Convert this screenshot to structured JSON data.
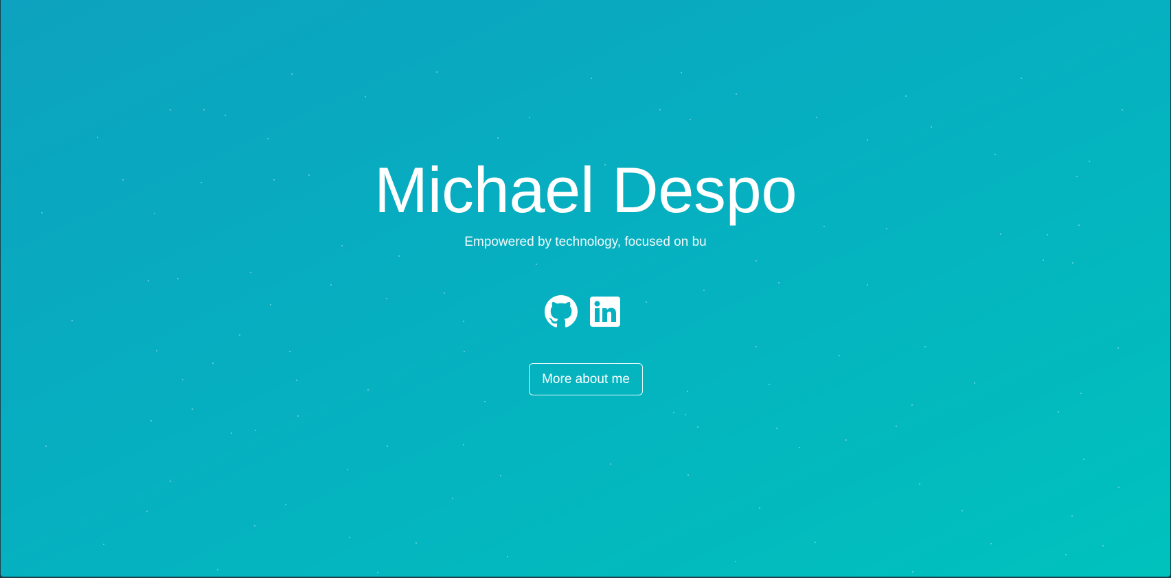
{
  "hero": {
    "title": "Michael Despo",
    "subtitle": "Empowered by technology, focused on bu",
    "accent_gradient": [
      "#0da2bf",
      "#06afc0",
      "#00c2bd"
    ]
  },
  "socials": [
    {
      "icon": "github-icon",
      "label": "GitHub"
    },
    {
      "icon": "linkedin-icon",
      "label": "LinkedIn"
    }
  ],
  "cta": {
    "label": "More about me"
  }
}
